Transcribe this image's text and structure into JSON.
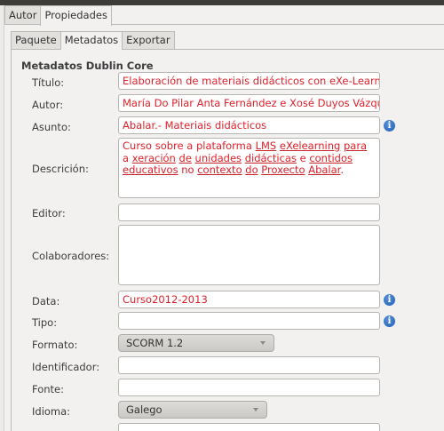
{
  "outer_tabs": [
    {
      "label": "Autor",
      "active": false
    },
    {
      "label": "Propiedades",
      "active": true
    }
  ],
  "inner_tabs": [
    {
      "label": "Paquete",
      "active": false
    },
    {
      "label": "Metadatos",
      "active": true
    },
    {
      "label": "Exportar",
      "active": false
    }
  ],
  "section_title": "Metadatos Dublin Core",
  "fields": {
    "titulo": {
      "label": "Título:",
      "value": "Elaboración de materiais didácticos con eXe-Learning. Ed"
    },
    "autor": {
      "label": "Autor:",
      "value": "María Do Pilar Anta Fernández e Xosé Duyos Vázquez"
    },
    "asunto": {
      "label": "Asunto:",
      "value": "Abalar.- Materiais didácticos"
    },
    "descricion": {
      "label": "Descrición:",
      "value_parts": [
        {
          "text": "Curso sobre a plataforma ",
          "underline": false
        },
        {
          "text": "LMS",
          "underline": true
        },
        {
          "text": " ",
          "underline": false
        },
        {
          "text": "eXelearning",
          "underline": true
        },
        {
          "text": " ",
          "underline": false
        },
        {
          "text": "para",
          "underline": true
        },
        {
          "text": " a ",
          "underline": false
        },
        {
          "text": "xeración",
          "underline": true
        },
        {
          "text": " ",
          "underline": false
        },
        {
          "text": "de",
          "underline": true
        },
        {
          "text": " ",
          "underline": false
        },
        {
          "text": "unidades",
          "underline": true
        },
        {
          "text": " ",
          "underline": false
        },
        {
          "text": "didácticas",
          "underline": true
        },
        {
          "text": " e ",
          "underline": false
        },
        {
          "text": "contidos",
          "underline": true
        },
        {
          "text": " ",
          "underline": false
        },
        {
          "text": "educativos",
          "underline": true
        },
        {
          "text": " no ",
          "underline": false
        },
        {
          "text": "contexto",
          "underline": true
        },
        {
          "text": " ",
          "underline": false
        },
        {
          "text": "do",
          "underline": true
        },
        {
          "text": " ",
          "underline": false
        },
        {
          "text": "Proxecto",
          "underline": true
        },
        {
          "text": " ",
          "underline": false
        },
        {
          "text": "Abalar",
          "underline": true
        },
        {
          "text": ".",
          "underline": false
        }
      ]
    },
    "editor": {
      "label": "Editor:",
      "value": ""
    },
    "colaboradores": {
      "label": "Colaboradores:",
      "value": ""
    },
    "data": {
      "label": "Data:",
      "value": "Curso2012-2013"
    },
    "tipo": {
      "label": "Tipo:",
      "value": ""
    },
    "formato": {
      "label": "Formato:",
      "selected": "SCORM 1.2"
    },
    "identificador": {
      "label": "Identificador:",
      "value": ""
    },
    "fonte": {
      "label": "Fonte:",
      "value": ""
    },
    "idioma": {
      "label": "Idioma:",
      "selected": "Galego"
    }
  },
  "icons": {
    "info": "info-icon"
  },
  "colors": {
    "field_text": "#e0202a",
    "info_icon": "#1c5fb8",
    "topbar": "#3d3c38"
  }
}
